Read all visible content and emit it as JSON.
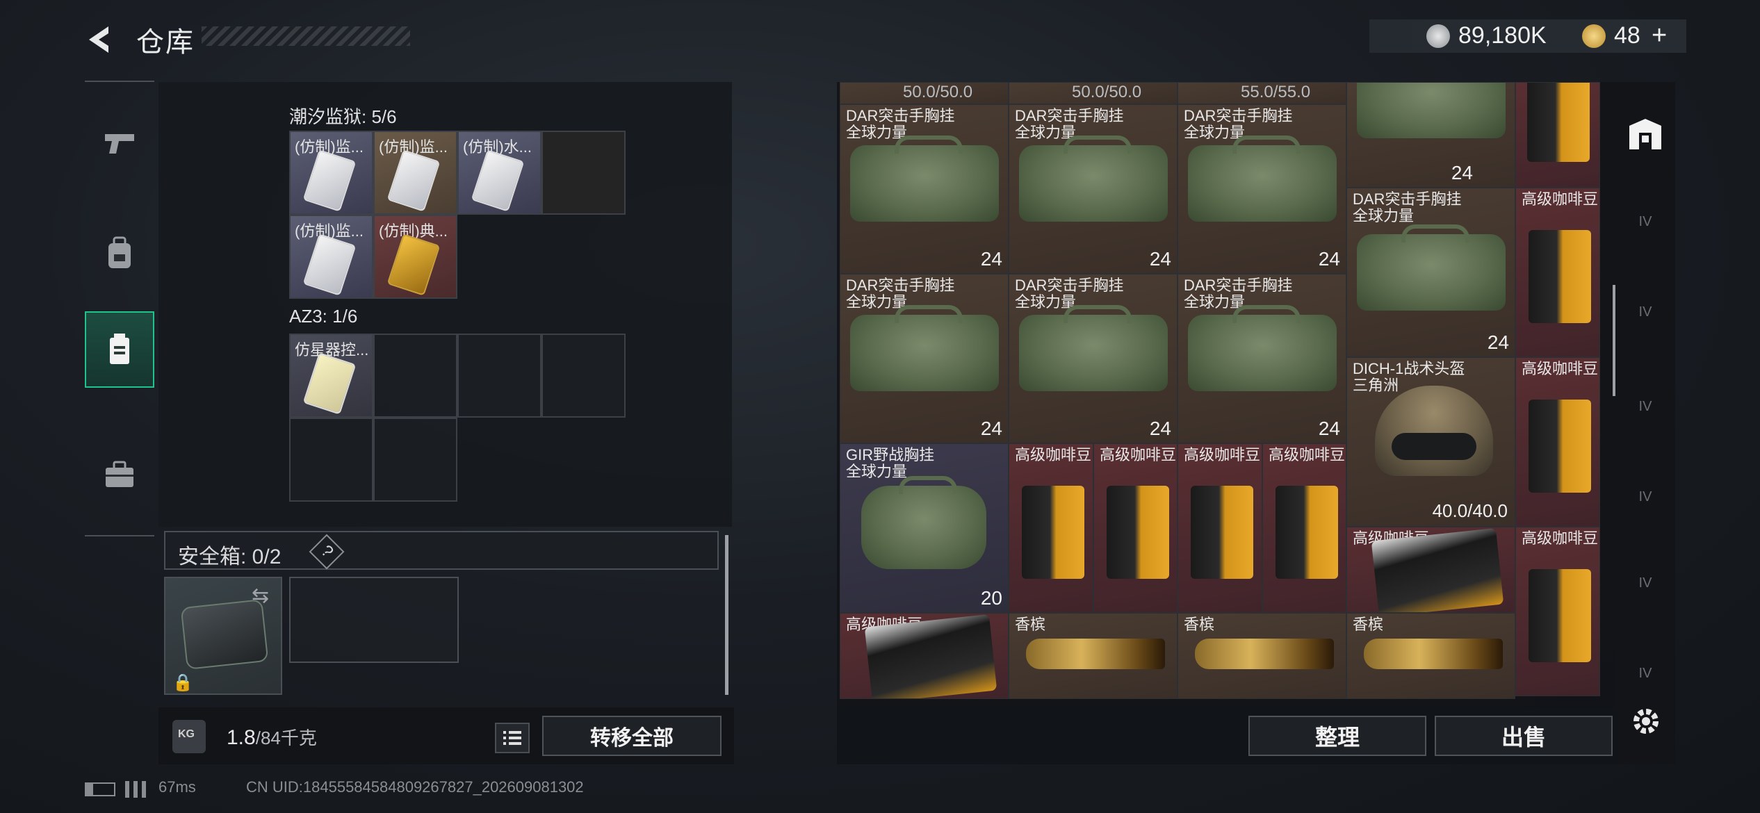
{
  "header": {
    "title": "仓库",
    "silver_value": "89,180K",
    "gold_value": "48",
    "gold_plus": "+"
  },
  "left_tabs": [
    {
      "icon": "pistol-icon"
    },
    {
      "icon": "backpack-icon"
    },
    {
      "icon": "container-icon",
      "active": true
    },
    {
      "icon": "briefcase-icon"
    }
  ],
  "stash": {
    "prison_label": "潮汐监狱: 5/6",
    "prison_items": [
      "(仿制)监...",
      "(仿制)监...",
      "(仿制)水...",
      "(仿制)监...",
      "(仿制)典..."
    ],
    "az3_label": "AZ3: 1/6",
    "az3_items": [
      "仿星器控..."
    ],
    "safe_label": "安全箱: 0/2",
    "safe_help": "?"
  },
  "weight": {
    "current": "1.8",
    "max": "/84千克"
  },
  "buttons": {
    "transfer_all": "转移全部",
    "sort": "整理",
    "sell": "出售"
  },
  "status": {
    "ping": "67ms",
    "uid": "CN UID:18455584584809267827_202609081302"
  },
  "grid_header": [
    "50.0/50.0",
    "50.0/50.0",
    "55.0/55.0"
  ],
  "grid": {
    "dar_name_1": "DAR突击手胸挂",
    "dar_name_2": "全球力量",
    "dar_count": "24",
    "gir_name_1": "GIR野战胸挂",
    "gir_name_2": "全球力量",
    "gir_count": "20",
    "coffee": "高级咖啡豆",
    "champagne": "香槟",
    "helmet_name_1": "DICH-1战术头盔",
    "helmet_name_2": "三角洲",
    "helmet_dur": "40.0/40.0"
  },
  "side_tabs": [
    "IV",
    "IV",
    "IV",
    "IV",
    "IV",
    "IV"
  ]
}
